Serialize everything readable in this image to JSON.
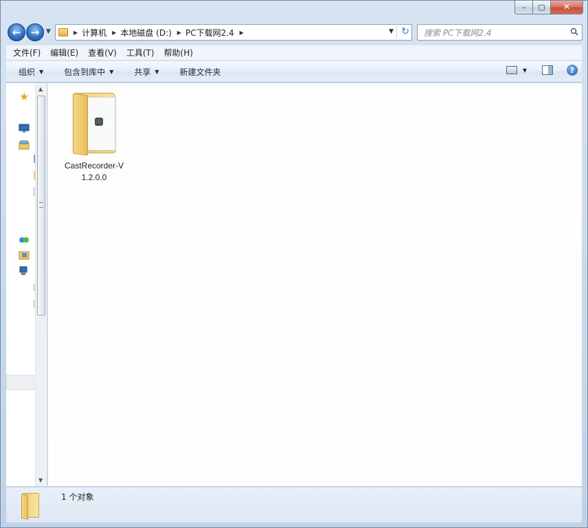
{
  "window": {
    "caption": {
      "minimize": "–",
      "maximize": "▢",
      "close": "✕"
    }
  },
  "nav": {
    "back_icon": "arrow-left-icon",
    "forward_icon": "arrow-right-icon",
    "breadcrumb": [
      "计算机",
      "本地磁盘 (D:)",
      "PC下载网2.4"
    ],
    "search_placeholder": "搜索 PC下载网2.4"
  },
  "menubar": {
    "items": [
      "文件(F)",
      "编辑(E)",
      "查看(V)",
      "工具(T)",
      "帮助(H)"
    ]
  },
  "commandbar": {
    "organize": "组织",
    "include_library": "包含到库中",
    "share": "共享",
    "new_folder": "新建文件夹",
    "help": "?"
  },
  "content": {
    "items": [
      {
        "name_line1": "CastRecorder-V",
        "name_line2": "1.2.0.0",
        "icon": "folder-icon"
      }
    ]
  },
  "statusbar": {
    "text": "1 个对象"
  },
  "colors": {
    "frame": "#c9d8ea",
    "folder": "#f2d27b",
    "accent": "#2b6cc0"
  }
}
